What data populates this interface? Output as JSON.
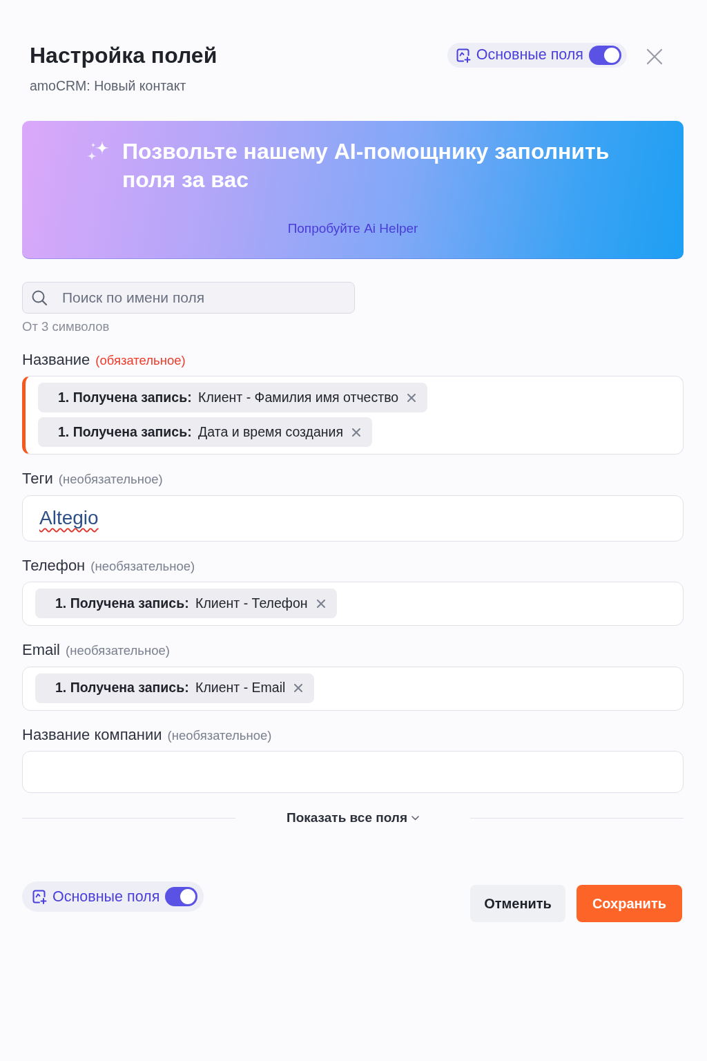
{
  "dialog": {
    "title": "Настройка полей",
    "subtitle": "amoCRM: Новый контакт"
  },
  "header_toggle": {
    "label": "Основные поля",
    "on": true
  },
  "ai_banner": {
    "title": "Позвольте нашему AI-помощнику заполнить поля за вас",
    "link": "Попробуйте Ai Helper"
  },
  "search": {
    "placeholder": "Поиск по имени поля",
    "hint": "От 3 символов"
  },
  "fields": [
    {
      "label": "Название",
      "note": "(обязательное)",
      "required": true,
      "kind": "chips",
      "chips": [
        "**1. Получена запись:** Клиент - Фамилия имя отчество",
        "**1. Получена запись:** Дата и время создания"
      ]
    },
    {
      "label": "Теги",
      "note": "(необязательное)",
      "required": false,
      "kind": "text",
      "value": "Altegio",
      "misspelled": true
    },
    {
      "label": "Телефон",
      "note": "(необязательное)",
      "required": false,
      "kind": "chips",
      "chips": [
        "**1. Получена запись:** Клиент - Телефон"
      ]
    },
    {
      "label": "Email",
      "note": "(необязательное)",
      "required": false,
      "kind": "chips",
      "chips": [
        "**1. Получена запись:** Клиент - Email"
      ]
    },
    {
      "label": "Название компании",
      "note": "(необязательное)",
      "required": false,
      "kind": "text"
    }
  ],
  "show_all": {
    "label": "Показать все поля"
  },
  "footer": {
    "toggle": {
      "label": "Основные поля",
      "on": true
    },
    "buttons": [
      {
        "label": "Отменить",
        "kind": "secondary"
      },
      {
        "label": "Сохранить",
        "kind": "primary"
      }
    ]
  }
}
